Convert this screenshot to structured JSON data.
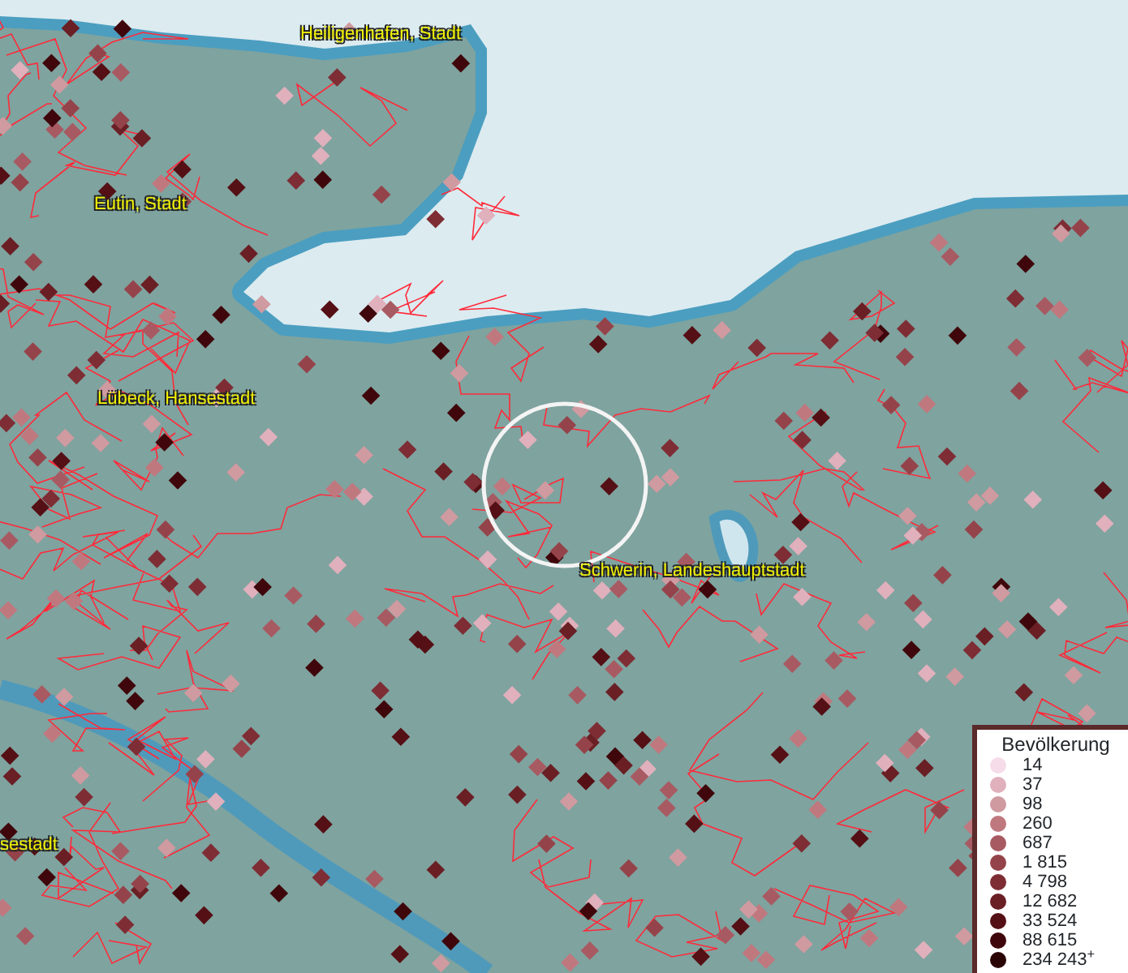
{
  "map": {
    "place_labels": [
      {
        "text": "Heiligenhafen, Stadt"
      },
      {
        "text": "Eutin, Stadt"
      },
      {
        "text": "Lübeck, Hansestadt"
      },
      {
        "text": "Schwerin, Landeshauptstadt"
      },
      {
        "text": "sestadt"
      }
    ]
  },
  "legend": {
    "title": "Bevölkerung",
    "entries": [
      {
        "label": "14",
        "color": "#f5dce8"
      },
      {
        "label": "37",
        "color": "#e0b0bc"
      },
      {
        "label": "98",
        "color": "#cf9aa0"
      },
      {
        "label": "260",
        "color": "#c0787f"
      },
      {
        "label": "687",
        "color": "#a85a62"
      },
      {
        "label": "1 815",
        "color": "#95434a"
      },
      {
        "label": "4 798",
        "color": "#7e2d35"
      },
      {
        "label": "12 682",
        "color": "#6a1f25"
      },
      {
        "label": "33 524",
        "color": "#551015"
      },
      {
        "label": "88 615",
        "color": "#3f070b"
      },
      {
        "label": "234 243$^{+}$",
        "color": "#2a0305"
      }
    ]
  }
}
